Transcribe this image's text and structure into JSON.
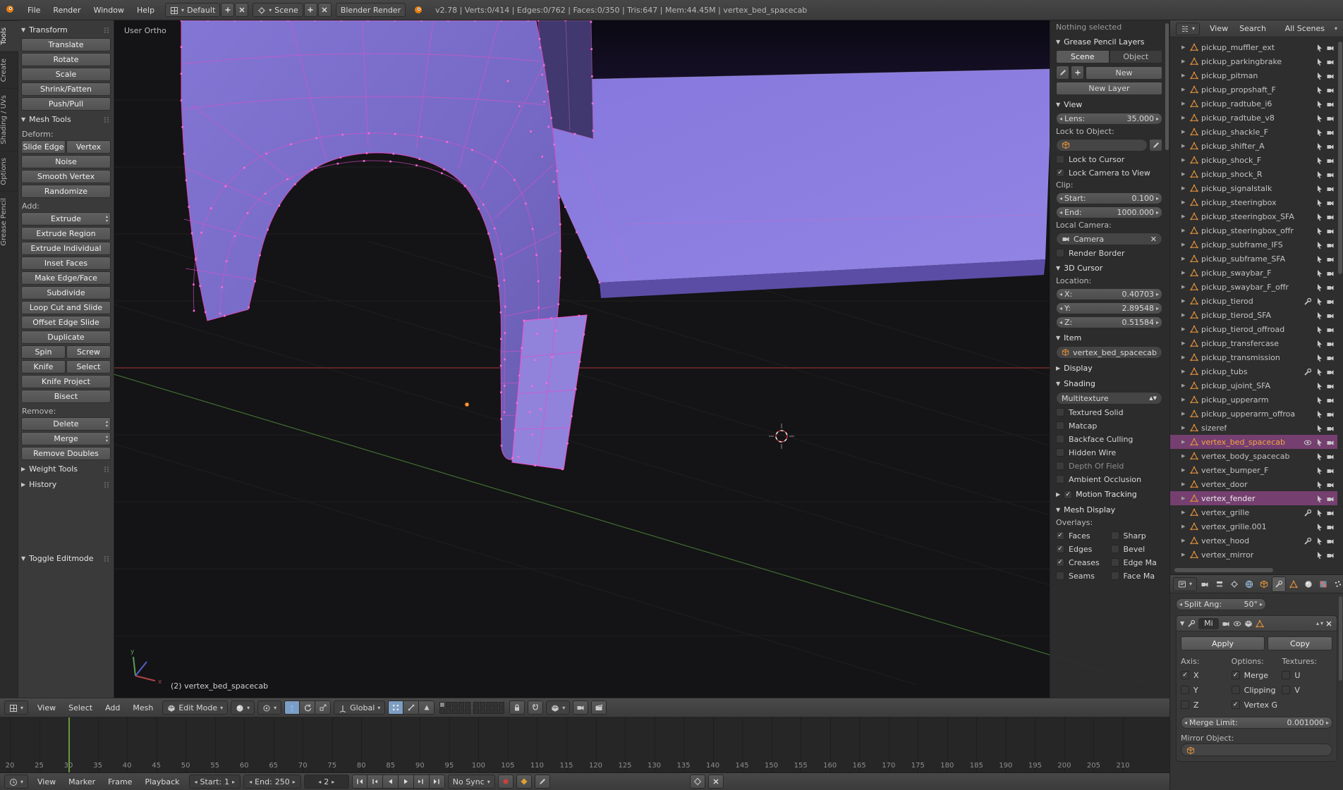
{
  "topbar": {
    "menus": [
      "File",
      "Render",
      "Window",
      "Help"
    ],
    "layout": "Default",
    "scene": "Scene",
    "engine": "Blender Render",
    "stats": "v2.78 | Verts:0/414 | Edges:0/762 | Faces:0/350 | Tris:647 | Mem:44.45M | vertex_bed_spacecab"
  },
  "toolshelf": {
    "tabs": [
      "Tools",
      "Create",
      "Shading / UVs",
      "Options",
      "Grease Pencil"
    ],
    "active_tab": "Tools",
    "transform": {
      "title": "Transform",
      "buttons": [
        "Translate",
        "Rotate",
        "Scale",
        "Shrink/Fatten",
        "Push/Pull"
      ]
    },
    "mesh_tools": {
      "title": "Mesh Tools",
      "items": [
        {
          "k": "label",
          "t": "Deform:"
        },
        {
          "k": "row",
          "b": [
            {
              "t": "Slide Edge"
            },
            {
              "t": "Vertex"
            }
          ]
        },
        {
          "k": "row",
          "b": [
            {
              "t": "Noise"
            }
          ]
        },
        {
          "k": "row",
          "b": [
            {
              "t": "Smooth Vertex"
            }
          ]
        },
        {
          "k": "row",
          "b": [
            {
              "t": "Randomize"
            }
          ]
        },
        {
          "k": "label",
          "t": "Add:"
        },
        {
          "k": "row",
          "b": [
            {
              "t": "Extrude",
              "m": true
            }
          ]
        },
        {
          "k": "row",
          "b": [
            {
              "t": "Extrude Region"
            }
          ]
        },
        {
          "k": "row",
          "b": [
            {
              "t": "Extrude Individual"
            }
          ]
        },
        {
          "k": "row",
          "b": [
            {
              "t": "Inset Faces"
            }
          ]
        },
        {
          "k": "row",
          "b": [
            {
              "t": "Make Edge/Face"
            }
          ]
        },
        {
          "k": "row",
          "b": [
            {
              "t": "Subdivide"
            }
          ]
        },
        {
          "k": "row",
          "b": [
            {
              "t": "Loop Cut and Slide"
            }
          ]
        },
        {
          "k": "row",
          "b": [
            {
              "t": "Offset Edge Slide"
            }
          ]
        },
        {
          "k": "row",
          "b": [
            {
              "t": "Duplicate"
            }
          ]
        },
        {
          "k": "row",
          "b": [
            {
              "t": "Spin"
            },
            {
              "t": "Screw"
            }
          ]
        },
        {
          "k": "row",
          "b": [
            {
              "t": "Knife"
            },
            {
              "t": "Select"
            }
          ]
        },
        {
          "k": "row",
          "b": [
            {
              "t": "Knife Project"
            }
          ]
        },
        {
          "k": "row",
          "b": [
            {
              "t": "Bisect"
            }
          ]
        },
        {
          "k": "label",
          "t": "Remove:"
        },
        {
          "k": "row",
          "b": [
            {
              "t": "Delete",
              "m": true
            }
          ]
        },
        {
          "k": "row",
          "b": [
            {
              "t": "Merge",
              "m": true
            }
          ]
        },
        {
          "k": "row",
          "b": [
            {
              "t": "Remove Doubles"
            }
          ]
        }
      ]
    },
    "collapsed_panels": [
      "Weight Tools",
      "History"
    ],
    "redo_panel": "Toggle Editmode"
  },
  "viewport": {
    "view_label": "User Ortho",
    "object_label": "(2) vertex_bed_spacecab",
    "header": {
      "menus": [
        "View",
        "Select",
        "Add",
        "Mesh"
      ],
      "mode": "Edit Mode",
      "orientation": "Global"
    }
  },
  "npanel": {
    "top_text": "Nothing selected",
    "items": [
      {
        "k": "header",
        "t": "Grease Pencil Layers",
        "open": true
      },
      {
        "k": "tabs",
        "tabs": [
          "Scene",
          "Object"
        ],
        "active": 0
      },
      {
        "k": "gprow",
        "t": "New"
      },
      {
        "k": "button",
        "t": "New Layer"
      },
      {
        "k": "header",
        "t": "View",
        "open": true
      },
      {
        "k": "num",
        "label": "Lens:",
        "value": "35.000"
      },
      {
        "k": "label",
        "t": "Lock to Object:"
      },
      {
        "k": "objfield"
      },
      {
        "k": "check",
        "t": "Lock to Cursor",
        "c": false
      },
      {
        "k": "check",
        "t": "Lock Camera to View",
        "c": true
      },
      {
        "k": "label",
        "t": "Clip:"
      },
      {
        "k": "num",
        "label": "Start:",
        "value": "0.100"
      },
      {
        "k": "num",
        "label": "End:",
        "value": "1000.000"
      },
      {
        "k": "label",
        "t": "Local Camera:"
      },
      {
        "k": "field",
        "t": "Camera",
        "icon": "cam",
        "x": true
      },
      {
        "k": "check",
        "t": "Render Border",
        "c": false
      },
      {
        "k": "header",
        "t": "3D Cursor",
        "open": true
      },
      {
        "k": "label",
        "t": "Location:"
      },
      {
        "k": "num",
        "label": "X:",
        "value": "0.40703"
      },
      {
        "k": "num",
        "label": "Y:",
        "value": "2.89548"
      },
      {
        "k": "num",
        "label": "Z:",
        "value": "0.51584"
      },
      {
        "k": "header",
        "t": "Item",
        "open": true
      },
      {
        "k": "field",
        "t": "vertex_bed_spacecab",
        "icon": "cube"
      },
      {
        "k": "header",
        "t": "Display",
        "open": false
      },
      {
        "k": "header",
        "t": "Shading",
        "open": true
      },
      {
        "k": "dropdown",
        "t": "Multitexture"
      },
      {
        "k": "check",
        "t": "Textured Solid",
        "c": false
      },
      {
        "k": "check",
        "t": "Matcap",
        "c": false
      },
      {
        "k": "check",
        "t": "Backface Culling",
        "c": false
      },
      {
        "k": "check",
        "t": "Hidden Wire",
        "c": false
      },
      {
        "k": "check",
        "t": "Depth Of Field",
        "c": false,
        "dis": true
      },
      {
        "k": "check",
        "t": "Ambient Occlusion",
        "c": false
      },
      {
        "k": "header",
        "t": "Motion Tracking",
        "open": false,
        "chk": true
      },
      {
        "k": "header",
        "t": "Mesh Display",
        "open": true
      },
      {
        "k": "label",
        "t": "Overlays:"
      },
      {
        "k": "check2",
        "a": {
          "t": "Faces",
          "c": true
        },
        "b": {
          "t": "Sharp",
          "c": false
        }
      },
      {
        "k": "check2",
        "a": {
          "t": "Edges",
          "c": true
        },
        "b": {
          "t": "Bevel",
          "c": false
        }
      },
      {
        "k": "check2",
        "a": {
          "t": "Creases",
          "c": true
        },
        "b": {
          "t": "Edge Ma",
          "c": false
        }
      },
      {
        "k": "check2",
        "a": {
          "t": "Seams",
          "c": false
        },
        "b": {
          "t": "Face Ma",
          "c": false
        }
      }
    ]
  },
  "outliner": {
    "header": {
      "view": "View",
      "search": "Search",
      "scenes": "All Scenes"
    },
    "rows": [
      {
        "name": "pickup_muffler_ext"
      },
      {
        "name": "pickup_parkingbrake"
      },
      {
        "name": "pickup_pitman"
      },
      {
        "name": "pickup_propshaft_F"
      },
      {
        "name": "pickup_radtube_i6"
      },
      {
        "name": "pickup_radtube_v8"
      },
      {
        "name": "pickup_shackle_F"
      },
      {
        "name": "pickup_shifter_A"
      },
      {
        "name": "pickup_shock_F"
      },
      {
        "name": "pickup_shock_R"
      },
      {
        "name": "pickup_signalstalk"
      },
      {
        "name": "pickup_steeringbox"
      },
      {
        "name": "pickup_steeringbox_SFA"
      },
      {
        "name": "pickup_steeringbox_offr"
      },
      {
        "name": "pickup_subframe_IFS"
      },
      {
        "name": "pickup_subframe_SFA"
      },
      {
        "name": "pickup_swaybar_F"
      },
      {
        "name": "pickup_swaybar_F_offr"
      },
      {
        "name": "pickup_tierod",
        "wrench": true
      },
      {
        "name": "pickup_tierod_SFA"
      },
      {
        "name": "pickup_tierod_offroad"
      },
      {
        "name": "pickup_transfercase"
      },
      {
        "name": "pickup_transmission"
      },
      {
        "name": "pickup_tubs",
        "wrench": true
      },
      {
        "name": "pickup_ujoint_SFA"
      },
      {
        "name": "pickup_upperarm"
      },
      {
        "name": "pickup_upperarm_offroa"
      },
      {
        "name": "sizeref"
      },
      {
        "name": "vertex_bed_spacecab",
        "sel": "active",
        "eye": true
      },
      {
        "name": "vertex_body_spacecab"
      },
      {
        "name": "vertex_bumper_F"
      },
      {
        "name": "vertex_door"
      },
      {
        "name": "vertex_fender",
        "sel": "selected"
      },
      {
        "name": "vertex_grille",
        "wrench": true
      },
      {
        "name": "vertex_grille.001"
      },
      {
        "name": "vertex_hood",
        "wrench": true
      },
      {
        "name": "vertex_mirror"
      }
    ]
  },
  "properties": {
    "tabs": [
      {
        "icon": "cam"
      },
      {
        "icon": "layers"
      },
      {
        "icon": "scene"
      },
      {
        "icon": "world"
      },
      {
        "icon": "cube"
      },
      {
        "icon": "wrench",
        "active": true
      },
      {
        "icon": "mesh"
      },
      {
        "icon": "sphere"
      },
      {
        "icon": "checker"
      },
      {
        "icon": "particles"
      },
      {
        "icon": "physics"
      }
    ],
    "split_ang": {
      "label": "Split Ang:",
      "value": "50°"
    },
    "modifier": {
      "name": "Mi",
      "apply": "Apply",
      "copy": "Copy",
      "columns": [
        {
          "label": "Axis:",
          "checks": [
            {
              "t": "X",
              "c": true
            },
            {
              "t": "Y",
              "c": false
            },
            {
              "t": "Z",
              "c": false
            }
          ]
        },
        {
          "label": "Options:",
          "checks": [
            {
              "t": "Merge",
              "c": true
            },
            {
              "t": "Clipping",
              "c": false
            },
            {
              "t": "Vertex G",
              "c": true
            }
          ]
        },
        {
          "label": "Textures:",
          "checks": [
            {
              "t": "U",
              "c": false
            },
            {
              "t": "V",
              "c": false
            }
          ]
        }
      ],
      "merge_limit": {
        "label": "Merge Limit:",
        "value": "0.001000"
      },
      "mirror_label": "Mirror Object:"
    }
  },
  "timeline": {
    "menus": [
      "View",
      "Marker",
      "Frame",
      "Playback"
    ],
    "start_label": "Start:",
    "start": "1",
    "end_label": "End:",
    "end": "250",
    "frame": "2",
    "sync": "No Sync",
    "ruler": {
      "first": 20,
      "last": 210,
      "step": 5
    },
    "playhead_frame": 30
  },
  "colors": {
    "accent_orange": "#f5a344",
    "mesh_purple": "#8678dd",
    "wire_pink": "#e050c8",
    "select_highlight": "#753f70"
  }
}
